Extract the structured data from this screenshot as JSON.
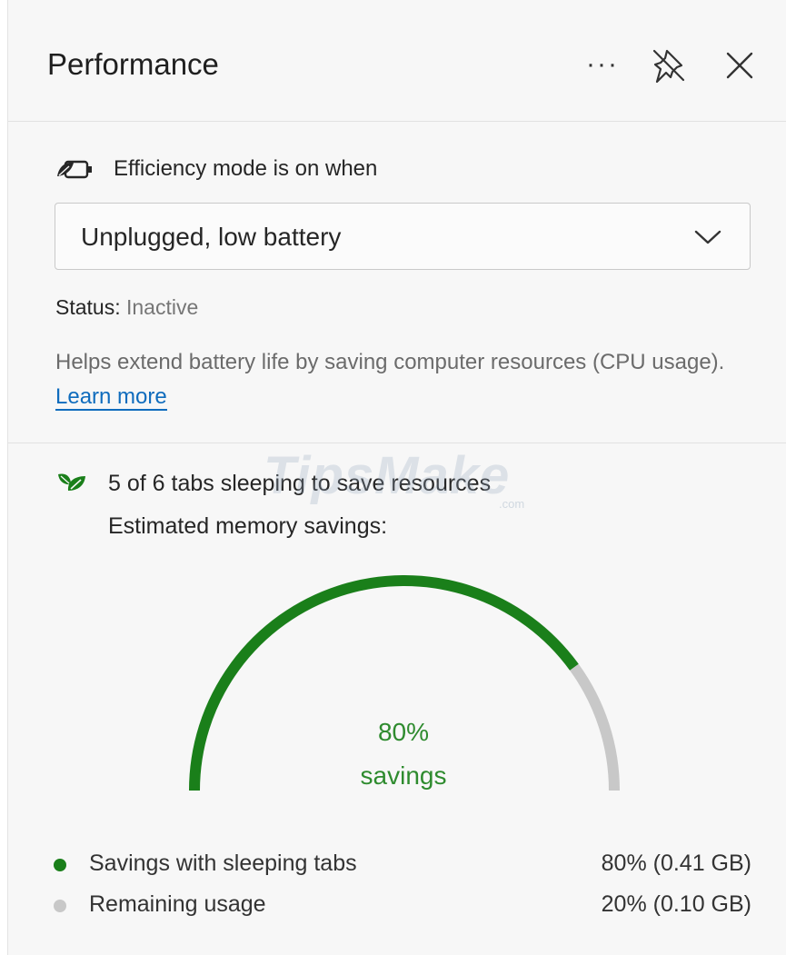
{
  "header": {
    "title": "Performance",
    "more_icon": "more-horizontal-icon",
    "pin_icon": "unpin-icon",
    "close_icon": "close-icon"
  },
  "efficiency": {
    "icon": "battery-leaf-icon",
    "label": "Efficiency mode is on when",
    "dropdown_value": "Unplugged, low battery",
    "status_label": "Status:",
    "status_value": "Inactive",
    "help_text": "Helps extend battery life by saving computer resources (CPU usage).",
    "learn_more": "Learn more"
  },
  "sleeping": {
    "icon": "leaves-icon",
    "label": "5 of 6 tabs sleeping to save resources",
    "memory_label": "Estimated memory savings:",
    "watermark": "TipsMake",
    "watermark_sub": ".com"
  },
  "gauge": {
    "savings_fraction": 0.8,
    "percent_text": "80%",
    "caption": "savings",
    "colors": {
      "savings": "#1a7f1a",
      "remaining": "#c8c8c8"
    }
  },
  "legend": [
    {
      "label": "Savings with sleeping tabs",
      "amount": "80% (0.41 GB)",
      "color": "#1a7f1a"
    },
    {
      "label": "Remaining usage",
      "amount": "20% (0.10 GB)",
      "color": "#c8c8c8"
    }
  ]
}
